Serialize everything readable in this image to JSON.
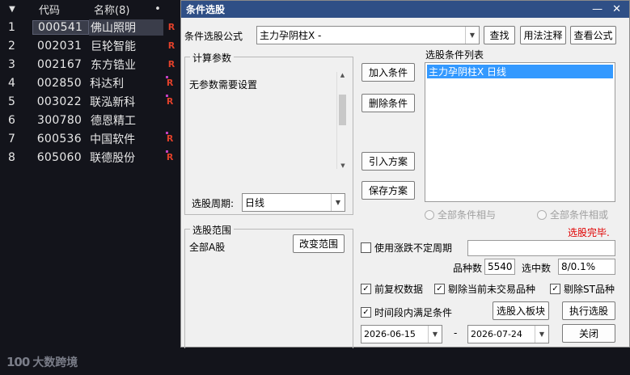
{
  "stock_list": {
    "header": {
      "sort_arrow": "▼",
      "code": "代码",
      "name": "名称(8)",
      "dot": "•"
    },
    "rows": [
      {
        "index": "1",
        "code": "000541",
        "name": "佛山照明",
        "flag": "R",
        "mark": false
      },
      {
        "index": "2",
        "code": "002031",
        "name": "巨轮智能",
        "flag": "R",
        "mark": false
      },
      {
        "index": "3",
        "code": "002167",
        "name": "东方锆业",
        "flag": "R",
        "mark": false
      },
      {
        "index": "4",
        "code": "002850",
        "name": "科达利",
        "flag": "R",
        "mark": true
      },
      {
        "index": "5",
        "code": "003022",
        "name": "联泓新科",
        "flag": "R",
        "mark": true
      },
      {
        "index": "6",
        "code": "300780",
        "name": "德恩精工",
        "flag": "",
        "mark": false
      },
      {
        "index": "7",
        "code": "600536",
        "name": "中国软件",
        "flag": "R",
        "mark": true
      },
      {
        "index": "8",
        "code": "605060",
        "name": "联德股份",
        "flag": "R",
        "mark": true
      }
    ]
  },
  "watermark": {
    "mark": "100",
    "text": "大数跨境"
  },
  "dialog": {
    "title": "条件选股",
    "minimize": "—",
    "close": "✕",
    "formula_label": "条件选股公式",
    "formula_value": "主力孕阴柱X  -",
    "find_btn": "查找",
    "usage_btn": "用法注释",
    "view_btn": "查看公式",
    "params_group": "计算参数",
    "params_text": "无参数需要设置",
    "period_label": "选股周期:",
    "period_value": "日线",
    "add_btn": "加入条件",
    "delete_btn": "删除条件",
    "import_btn": "引入方案",
    "save_btn": "保存方案",
    "conditions_label": "选股条件列表",
    "conditions": [
      "主力孕阴柱X  日线"
    ],
    "radio_and": "全部条件相与",
    "radio_or": "全部条件相或",
    "status": "选股完毕.",
    "range_group": "选股范围",
    "range_value": "全部A股",
    "change_range_btn": "改变范围",
    "use_var_period": "使用涨跌不定周期",
    "count_label": "品种数",
    "count_value": "5540",
    "selected_label": "选中数",
    "selected_value": "8/0.1%",
    "opt_prev_adjust": "前复权数据",
    "opt_exclude_untraded": "剔除当前未交易品种",
    "opt_exclude_st": "剔除ST品种",
    "opt_interval": "时间段内满足条件",
    "to_block_btn": "选股入板块",
    "execute_btn": "执行选股",
    "date_from": "2026-06-15",
    "date_sep": "-",
    "date_to": "2026-07-24",
    "close_btn": "关闭",
    "colors": {
      "title_bar": "#2f4f86",
      "list_selected": "#3399ff",
      "status": "#e00000"
    }
  }
}
